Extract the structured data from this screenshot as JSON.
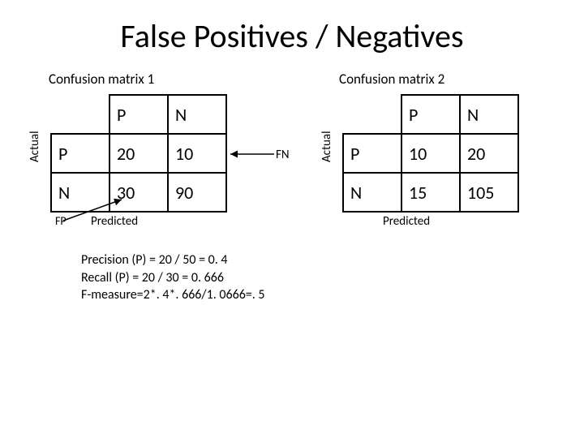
{
  "title": "False Positives / Negatives",
  "matrix1": {
    "label": "Confusion matrix 1",
    "col_P": "P",
    "col_N": "N",
    "row_P": "P",
    "row_N": "N",
    "tp": "20",
    "fn": "10",
    "fp": "30",
    "tn": "90",
    "ylabel": "Actual",
    "xlabel": "Predicted",
    "fp_tag": "FP",
    "fn_tag": "FN"
  },
  "matrix2": {
    "label": "Confusion matrix 2",
    "col_P": "P",
    "col_N": "N",
    "row_P": "P",
    "row_N": "N",
    "tp": "10",
    "fn": "20",
    "fp": "15",
    "tn": "105",
    "ylabel": "Actual",
    "xlabel": "Predicted"
  },
  "metrics": {
    "line1": "Precision (P) = 20 / 50 = 0. 4",
    "line2": "Recall (P) = 20 / 30 = 0. 666",
    "line3": "F-measure=2*. 4*. 666/1. 0666=. 5"
  },
  "chart_data": [
    {
      "type": "table",
      "title": "Confusion matrix 1",
      "row_labels": [
        "P",
        "N"
      ],
      "col_labels": [
        "P",
        "N"
      ],
      "values": [
        [
          20,
          10
        ],
        [
          30,
          90
        ]
      ],
      "row_axis": "Actual",
      "col_axis": "Predicted",
      "annotations": {
        "FN": [
          0,
          1
        ],
        "FP": [
          1,
          0
        ]
      }
    },
    {
      "type": "table",
      "title": "Confusion matrix 2",
      "row_labels": [
        "P",
        "N"
      ],
      "col_labels": [
        "P",
        "N"
      ],
      "values": [
        [
          10,
          20
        ],
        [
          15,
          105
        ]
      ],
      "row_axis": "Actual",
      "col_axis": "Predicted"
    }
  ]
}
